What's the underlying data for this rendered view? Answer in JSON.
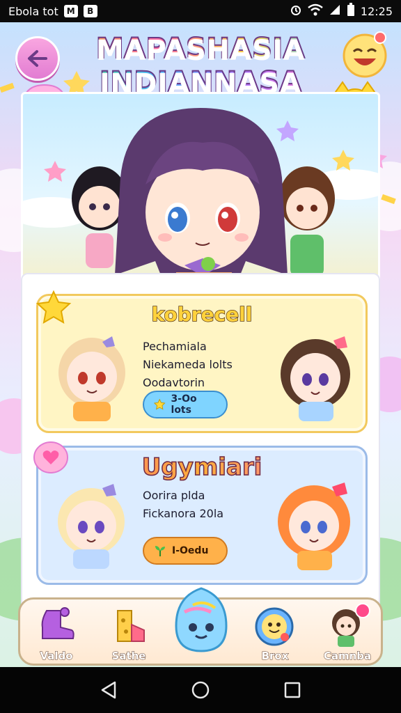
{
  "status_bar": {
    "carrier": "Ebola tot",
    "icon_1": "M",
    "icon_2": "B",
    "time": "12:25",
    "icons": [
      "alarm-icon",
      "wifi-icon",
      "signal-icon",
      "battery-icon"
    ]
  },
  "header": {
    "title_line1": "MAPASHASIA",
    "title_line2": "INDIANNASA",
    "back_icon": "back-arrow-icon",
    "emoji_icon": "laughing-face-icon"
  },
  "cards": [
    {
      "title": "kobrecell",
      "lines": [
        "Pechamiala",
        "Niekameda lolts",
        "Oodavtorin"
      ],
      "pill_label": "3-Oo lots",
      "pill_icon": "star-icon",
      "badge_icon": "star-badge-icon"
    },
    {
      "title": "Ugymiari",
      "lines": [
        "Oorira plda",
        "Fickanora 20la"
      ],
      "pill_label": "I-Oedu",
      "pill_icon": "sprout-icon",
      "badge_icon": "heart-badge-icon"
    }
  ],
  "bottom_nav": {
    "items": [
      {
        "label": "Valdo",
        "icon": "boot-icon"
      },
      {
        "label": "Sathe",
        "icon": "cheese-icon"
      },
      {
        "label": "",
        "icon": "slime-mascot-icon"
      },
      {
        "label": "Brox",
        "icon": "smiley-badge-icon"
      },
      {
        "label": "Camnba",
        "icon": "character-avatar-icon"
      }
    ]
  },
  "system_nav": {
    "icons": [
      "back-triangle-icon",
      "home-circle-icon",
      "recents-square-icon"
    ]
  },
  "colors": {
    "accent_pink": "#e27cd2",
    "card1_bg": "#fff5c4",
    "card2_bg": "#dcecff",
    "pill1": "#7fd4ff",
    "pill2": "#ffb14a"
  }
}
